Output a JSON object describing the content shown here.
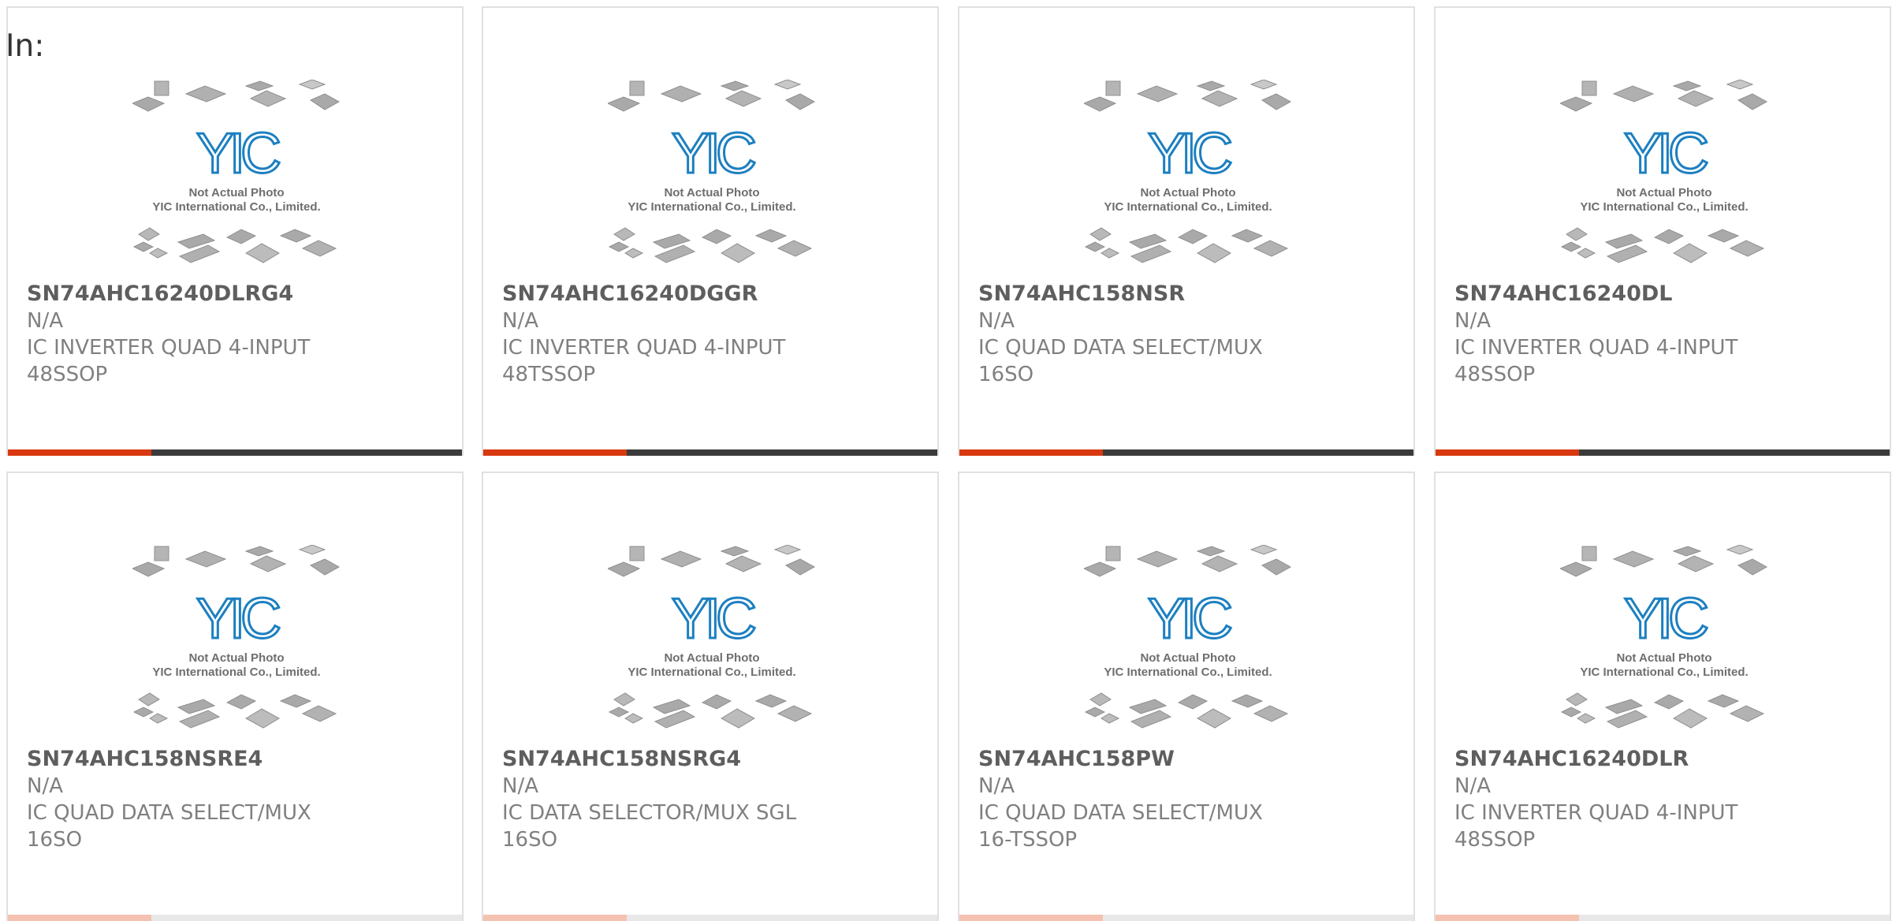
{
  "filter": {
    "label": "In:"
  },
  "brand": {
    "note": "Not Actual Photo",
    "company": "YIC International Co., Limited.",
    "logo": "YIC",
    "accent_color": "#d8380f",
    "logo_color": "#1c7fc0"
  },
  "products": [
    {
      "part": "SN74AHC16240DLRG4",
      "status": "N/A",
      "description": "IC INVERTER QUAD 4-INPUT 48SSOP"
    },
    {
      "part": "SN74AHC16240DGGR",
      "status": "N/A",
      "description": "IC INVERTER QUAD 4-INPUT 48TSSOP"
    },
    {
      "part": "SN74AHC158NSR",
      "status": "N/A",
      "description": "IC QUAD DATA SELECT/MUX 16SO"
    },
    {
      "part": "SN74AHC16240DL",
      "status": "N/A",
      "description": "IC INVERTER QUAD 4-INPUT 48SSOP"
    },
    {
      "part": "SN74AHC158NSRE4",
      "status": "N/A",
      "description": "IC QUAD DATA SELECT/MUX 16SO"
    },
    {
      "part": "SN74AHC158NSRG4",
      "status": "N/A",
      "description": "IC DATA SELECTOR/MUX SGL 16SO"
    },
    {
      "part": "SN74AHC158PW",
      "status": "N/A",
      "description": "IC QUAD DATA SELECT/MUX 16-TSSOP"
    },
    {
      "part": "SN74AHC16240DLR",
      "status": "N/A",
      "description": "IC INVERTER QUAD 4-INPUT 48SSOP"
    }
  ]
}
